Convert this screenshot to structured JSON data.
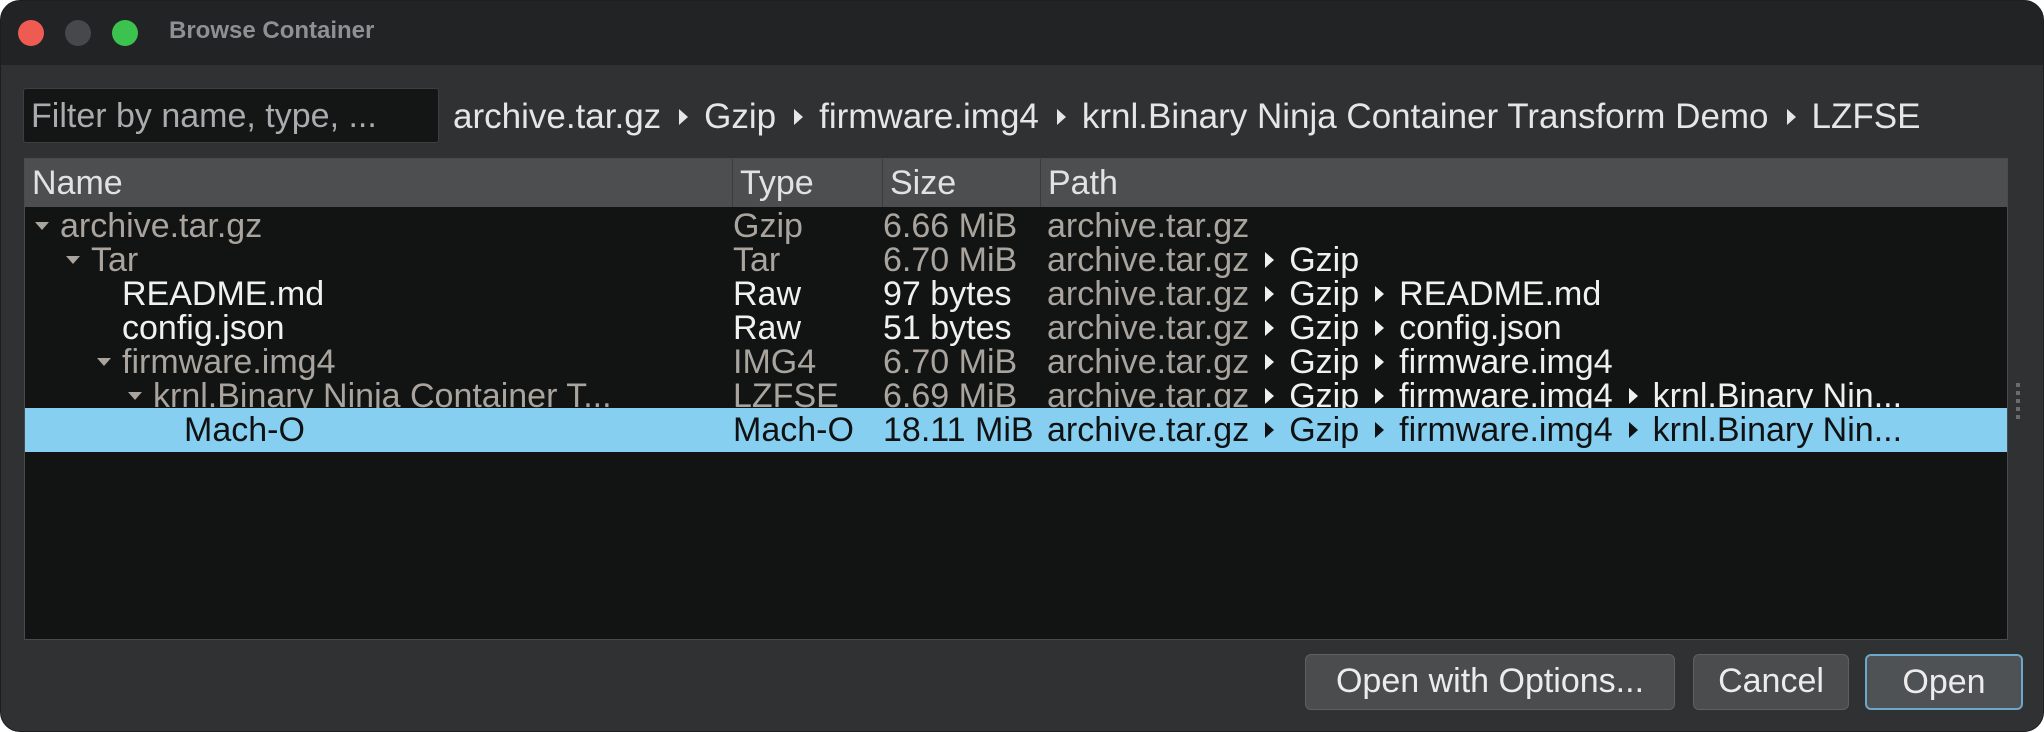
{
  "window": {
    "title": "Browse Container"
  },
  "filter": {
    "placeholder": "Filter by name, type, ..."
  },
  "breadcrumb": [
    "archive.tar.gz",
    "Gzip",
    "firmware.img4",
    "krnl.Binary Ninja Container Transform Demo",
    "LZFSE"
  ],
  "table": {
    "columns": {
      "name": "Name",
      "type": "Type",
      "size": "Size",
      "path": "Path"
    },
    "rows": [
      {
        "name": "archive.tar.gz",
        "type": "Gzip",
        "size": "6.66 MiB",
        "path": [
          "archive.tar.gz"
        ],
        "expanded": true,
        "depth": 0,
        "style": "dim",
        "selected": false
      },
      {
        "name": "Tar",
        "type": "Tar",
        "size": "6.70 MiB",
        "path": [
          "archive.tar.gz",
          "Gzip"
        ],
        "expanded": true,
        "depth": 1,
        "style": "dim",
        "selected": false
      },
      {
        "name": "README.md",
        "type": "Raw",
        "size": "97 bytes",
        "path": [
          "archive.tar.gz",
          "Gzip",
          "README.md"
        ],
        "expanded": false,
        "depth": 2,
        "style": "bright",
        "selected": false
      },
      {
        "name": "config.json",
        "type": "Raw",
        "size": "51 bytes",
        "path": [
          "archive.tar.gz",
          "Gzip",
          "config.json"
        ],
        "expanded": false,
        "depth": 2,
        "style": "bright",
        "selected": false
      },
      {
        "name": "firmware.img4",
        "type": "IMG4",
        "size": "6.70 MiB",
        "path": [
          "archive.tar.gz",
          "Gzip",
          "firmware.img4"
        ],
        "expanded": true,
        "depth": 2,
        "style": "dim",
        "selected": false
      },
      {
        "name": "krnl.Binary Ninja Container T...",
        "type": "LZFSE",
        "size": "6.69 MiB",
        "path": [
          "archive.tar.gz",
          "Gzip",
          "firmware.img4",
          "krnl.Binary Nin..."
        ],
        "expanded": true,
        "depth": 3,
        "style": "dim",
        "selected": false
      },
      {
        "name": "Mach-O",
        "type": "Mach-O",
        "size": "18.11 MiB",
        "path": [
          "archive.tar.gz",
          "Gzip",
          "firmware.img4",
          "krnl.Binary Nin..."
        ],
        "expanded": false,
        "depth": 4,
        "style": "dim",
        "selected": true
      }
    ]
  },
  "buttons": {
    "options_label": "Open with Options...",
    "cancel_label": "Cancel",
    "open_label": "Open"
  },
  "colors": {
    "selection": "#86cff0",
    "close": "#ee5b53",
    "maximize": "#3cc24e",
    "default_button_border": "#6da7cb"
  }
}
